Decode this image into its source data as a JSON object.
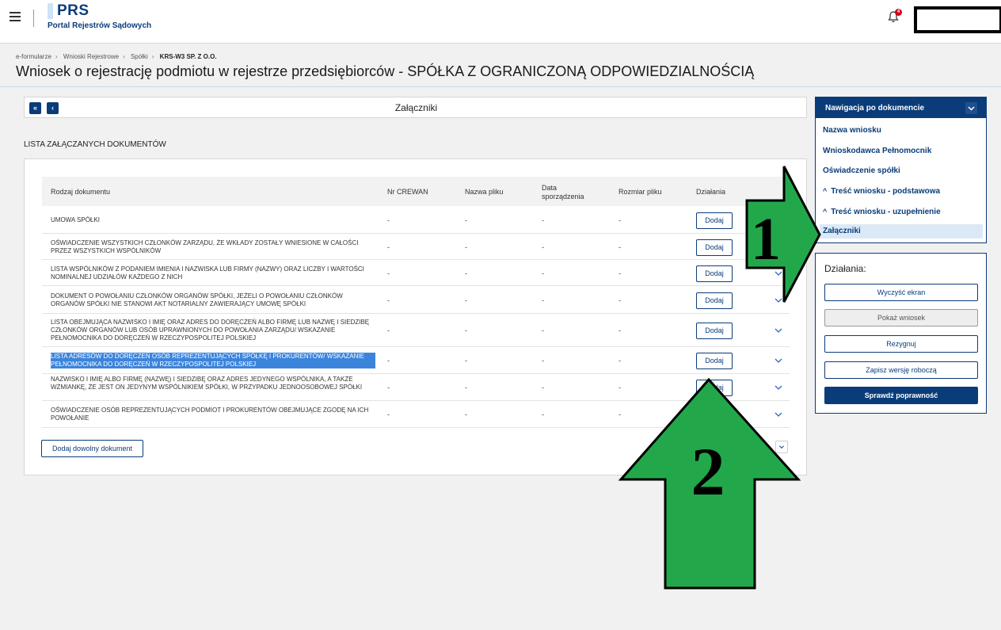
{
  "header": {
    "logo_title": "PRS",
    "logo_subtitle": "Portal Rejestrów Sądowych",
    "notification_count": "4"
  },
  "breadcrumb": [
    "e-formularze",
    "Wnioski Rejestrowe",
    "Spółki",
    "KRS-W3 SP. Z O.O."
  ],
  "page_title": "Wniosek o rejestrację podmiotu w rejestrze przedsiębiorców - SPÓŁKA Z OGRANICZONĄ ODPOWIEDZIALNOŚCIĄ",
  "section": {
    "title": "Załączniki",
    "first_label": "«",
    "prev_label": "‹"
  },
  "list_heading": "LISTA ZAŁĄCZANYCH DOKUMENTÓW",
  "table": {
    "columns": [
      "Rodzaj dokumentu",
      "Nr CREWAN",
      "Nazwa pliku",
      "Data sporządzenia",
      "Rozmiar pliku",
      "Działania"
    ],
    "rows": [
      {
        "doc": "UMOWA SPÓŁKI",
        "crewan": "-",
        "file": "-",
        "date": "-",
        "size": "-",
        "action": "Dodaj",
        "selected": false
      },
      {
        "doc": "OŚWIADCZENIE WSZYSTKICH CZŁONKÓW ZARZĄDU, ŻE WKŁADY ZOSTAŁY WNIESIONE W CAŁOŚCI PRZEZ WSZYSTKICH WSPÓLNIKÓW",
        "crewan": "-",
        "file": "-",
        "date": "-",
        "size": "-",
        "action": "Dodaj",
        "selected": false
      },
      {
        "doc": "LISTA WSPÓLNIKÓW Z PODANIEM IMIENIA I NAZWISKA LUB FIRMY (NAZWY) ORAZ LICZBY I WARTOŚCI NOMINALNEJ UDZIAŁÓW KAŻDEGO Z NICH",
        "crewan": "-",
        "file": "-",
        "date": "-",
        "size": "-",
        "action": "Dodaj",
        "selected": false
      },
      {
        "doc": "DOKUMENT O POWOŁANIU CZŁONKÓW ORGANÓW SPÓŁKI, JEŻELI O POWOŁANIU CZŁONKÓW ORGANÓW SPÓŁKI NIE STANOWI AKT NOTARIALNY ZAWIERAJĄCY UMOWĘ SPÓŁKI",
        "crewan": "-",
        "file": "-",
        "date": "-",
        "size": "-",
        "action": "Dodaj",
        "selected": false
      },
      {
        "doc": "LISTA OBEJMUJĄCA NAZWISKO I IMIĘ ORAZ ADRES DO DORĘCZEŃ ALBO FIRMĘ LUB NAZWĘ I SIEDZIBĘ CZŁONKÓW ORGANÓW LUB OSÓB UPRAWNIONYCH DO POWOŁANIA ZARZĄDU/ WSKAZANIE PEŁNOMOCNIKA DO DORĘCZEŃ W RZECZYPOSPOLITEJ POLSKIEJ",
        "crewan": "-",
        "file": "-",
        "date": "-",
        "size": "-",
        "action": "Dodaj",
        "selected": false
      },
      {
        "doc": "LISTA ADRESÓW DO DORĘCZEŃ OSÓB REPREZENTUJĄCYCH SPÓŁKĘ I PROKURENTÓW/ WSKAZANIE PEŁNOMOCNIKA DO DORĘCZEŃ W RZECZYPOSPOLITEJ POLSKIEJ",
        "crewan": "-",
        "file": "-",
        "date": "-",
        "size": "-",
        "action": "Dodaj",
        "selected": true
      },
      {
        "doc": "NAZWISKO I IMIĘ ALBO FIRMĘ (NAZWĘ) I SIEDZIBĘ ORAZ ADRES JEDYNEGO WSPÓLNIKA, A TAKŻE WZMIANKĘ, ŻE JEST ON JEDYNYM WSPÓLNIKIEM SPÓŁKI, W PRZYPADKU JEDNOOSOBOWEJ SPÓŁKI",
        "crewan": "-",
        "file": "-",
        "date": "-",
        "size": "-",
        "action": "Dodaj",
        "selected": false
      },
      {
        "doc": "OŚWIADCZENIE OSÓB REPREZENTUJĄCYCH PODMIOT I PROKURENTÓW OBEJMUJĄCE ZGODĘ NA ICH POWOŁANIE",
        "crewan": "-",
        "file": "-",
        "date": "-",
        "size": "-",
        "action": "Dodaj",
        "selected": false
      }
    ],
    "add_any_label": "Dodaj dowolny dokument"
  },
  "nav_panel": {
    "title": "Nawigacja po dokumencie",
    "items": [
      {
        "label": "Nazwa wniosku",
        "caret": ""
      },
      {
        "label": "Wnioskodawca Pełnomocnik",
        "caret": ""
      },
      {
        "label": "Oświadczenie spółki",
        "caret": ""
      },
      {
        "label": "Treść wniosku - podstawowa",
        "caret": "^"
      },
      {
        "label": "Treść wniosku - uzupełnienie",
        "caret": "^"
      },
      {
        "label": "Załączniki",
        "caret": ""
      }
    ]
  },
  "actions_panel": {
    "title": "Działania:",
    "buttons": [
      "Wyczyść ekran",
      "Pokaż wniosek",
      "Rezygnuj",
      "Zapisz wersję roboczą",
      "Sprawdź poprawność"
    ]
  },
  "annotations": {
    "arrow1_label": "1",
    "arrow2_label": "2",
    "arrow_color": "#22a84a"
  }
}
